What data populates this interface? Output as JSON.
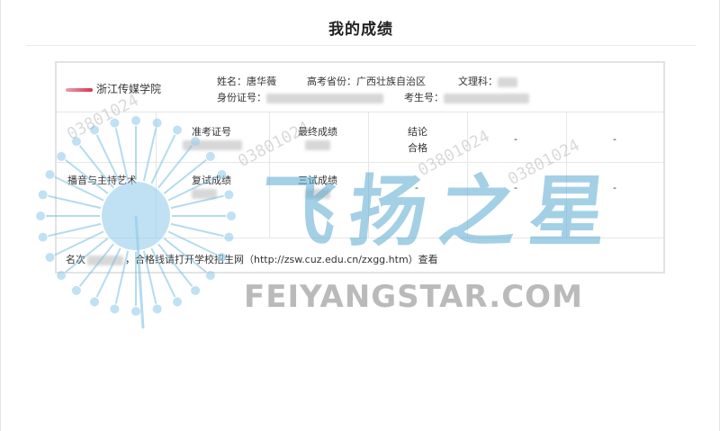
{
  "header": {
    "title": "我的成绩"
  },
  "card": {
    "school_name": "浙江传媒学院",
    "name_label": "姓名：",
    "name_value": "唐华薇",
    "province_label": "高考省份：",
    "province_value": "广西壮族自治区",
    "track_label": "文理科：",
    "id_label": "身份证号：",
    "exam_no_label": "考生号：",
    "major": "播音与主持艺术",
    "ticket_label": "准考证号",
    "final_score_label": "最终成绩",
    "conclusion_label": "结论",
    "conclusion_value": "合格",
    "retest_label": "复试成绩",
    "third_label": "三试成绩",
    "dash": "-",
    "footer_rank_label": "名次",
    "footer_note": "，合格线请打开学校招生网（http://zsw.cuz.edu.cn/zxgg.htm）查看"
  },
  "watermark": {
    "brand_cn": "飞扬之星",
    "brand_en": "FEIYANGSTAR.COM",
    "serial": "03801024"
  },
  "colors": {
    "watermark_blue": "#5aaad2",
    "watermark_gray": "#828282"
  }
}
